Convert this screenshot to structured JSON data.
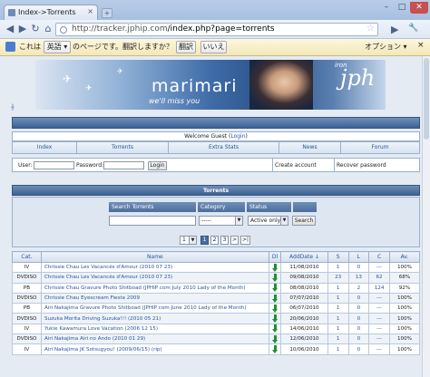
{
  "browser": {
    "tab_title": "Index->Torrents",
    "tab_close": "×",
    "new_tab": "+",
    "win_min": "–",
    "win_max": "□",
    "win_close": "✕",
    "url_host": "http://tracker.jphip.com",
    "url_path": "/index.php?page=torrents",
    "back": "◀",
    "forward": "▶",
    "reload": "↻",
    "home": "⌂",
    "star": "☆",
    "page_menu": "▶",
    "tools_menu": "🔧"
  },
  "translate_bar": {
    "prefix": "これは",
    "language": "英語",
    "question": "のページです。翻訳しますか？",
    "translate_btn": "翻訳",
    "no_btn": "いいえ",
    "options": "オプション",
    "close": "×"
  },
  "banner": {
    "logo_text": "marimari",
    "tagline": "we'll miss you",
    "script_text": "jph",
    "corner_text": "iron"
  },
  "header": {
    "welcome_prefix": "Welcome Guest (",
    "login_link": "Login",
    "welcome_suffix": ")"
  },
  "menu": [
    "Index",
    "Torrents",
    "Extra Stats",
    "News",
    "Forum"
  ],
  "login": {
    "user_label": "User:",
    "password_label": "Password:",
    "login_btn": "Login",
    "create_account": "Create account",
    "recover_password": "Recover password"
  },
  "torrents_section": {
    "title": "Torrents",
    "search_label": "Search Torrents",
    "category_label": "Category",
    "status_label": "Status",
    "category_value": "-----",
    "status_value": "Active only",
    "search_btn": "Search",
    "pager_select": "1",
    "pages": [
      "1",
      "2",
      "3",
      ">",
      ">|"
    ]
  },
  "table": {
    "columns": [
      "Cat.",
      "Name",
      "Dl",
      "AddDate ↓",
      "S",
      "L",
      "C",
      "Av."
    ],
    "rows": [
      {
        "cat": "IV",
        "name": "Chrissie Chau Les Vacancés d'Amour (2010 07 23)",
        "date": "11/08/2010",
        "s": "1",
        "l": "0",
        "c": "---",
        "av": "100%"
      },
      {
        "cat": "DVDISO",
        "name": "Chrissie Chau Les Vacancés d'Amour (2010 07 23)",
        "date": "09/08/2010",
        "s": "23",
        "l": "13",
        "c": "62",
        "av": "68%"
      },
      {
        "cat": "PB",
        "name": "Chrissie Chau Gravure Photo Shitboad (JPHIP com July 2010 Lady of the Month)",
        "date": "08/08/2010",
        "s": "1",
        "l": "2",
        "c": "124",
        "av": "92%"
      },
      {
        "cat": "DVDISO",
        "name": "Chrissie Chau Eyescream Fiesta 2009",
        "date": "07/07/2010",
        "s": "1",
        "l": "0",
        "c": "---",
        "av": "100%"
      },
      {
        "cat": "PB",
        "name": "Airi Nakajima Gravure Photo Shitboad (JPHIP com June 2010 Lady of the Month)",
        "date": "06/07/2010",
        "s": "1",
        "l": "0",
        "c": "---",
        "av": "100%"
      },
      {
        "cat": "DVDISO",
        "name": "Suzuka Morita Driving Suzuka!!! (2010 05 21)",
        "date": "20/06/2010",
        "s": "1",
        "l": "0",
        "c": "---",
        "av": "100%"
      },
      {
        "cat": "IV",
        "name": "Yukie Kawamura Love Vacation (2006 12 15)",
        "date": "14/06/2010",
        "s": "1",
        "l": "0",
        "c": "---",
        "av": "100%"
      },
      {
        "cat": "DVDISO",
        "name": "Airi Nakajima Airi no Ando (2010 01 29)",
        "date": "12/06/2010",
        "s": "1",
        "l": "0",
        "c": "---",
        "av": "100%"
      },
      {
        "cat": "IV",
        "name": "Airi Nakajima JK Sotsugyou! (2009/06/15) (rip)",
        "date": "10/06/2010",
        "s": "1",
        "l": "0",
        "c": "---",
        "av": "100%"
      }
    ]
  }
}
